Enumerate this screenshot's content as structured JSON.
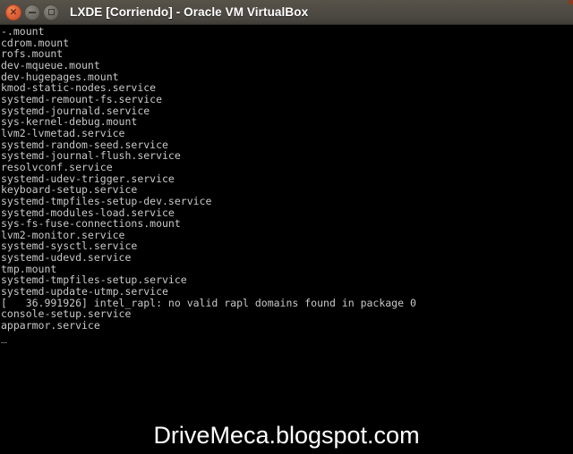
{
  "window": {
    "title": "LXDE [Corriendo] - Oracle VM VirtualBox",
    "buttons": {
      "close_label": "×",
      "minimize_label": "",
      "maximize_label": ""
    },
    "titlebar_color": "#4c4a45",
    "accent_close_color": "#e2643a"
  },
  "console": {
    "background_color": "#000000",
    "text_color": "#c9c9c9",
    "cursor": "_",
    "lines": [
      "-.mount",
      "cdrom.mount",
      "rofs.mount",
      "dev-mqueue.mount",
      "dev-hugepages.mount",
      "kmod-static-nodes.service",
      "systemd-remount-fs.service",
      "systemd-journald.service",
      "sys-kernel-debug.mount",
      "lvm2-lvmetad.service",
      "systemd-random-seed.service",
      "systemd-journal-flush.service",
      "resolvconf.service",
      "systemd-udev-trigger.service",
      "keyboard-setup.service",
      "systemd-tmpfiles-setup-dev.service",
      "systemd-modules-load.service",
      "sys-fs-fuse-connections.mount",
      "lvm2-monitor.service",
      "systemd-sysctl.service",
      "systemd-udevd.service",
      "tmp.mount",
      "systemd-tmpfiles-setup.service",
      "systemd-update-utmp.service",
      "[   36.991926] intel_rapl: no valid rapl domains found in package 0",
      "console-setup.service",
      "apparmor.service"
    ]
  },
  "watermark": {
    "text": "DriveMeca.blogspot.com",
    "color": "#ffffff"
  }
}
